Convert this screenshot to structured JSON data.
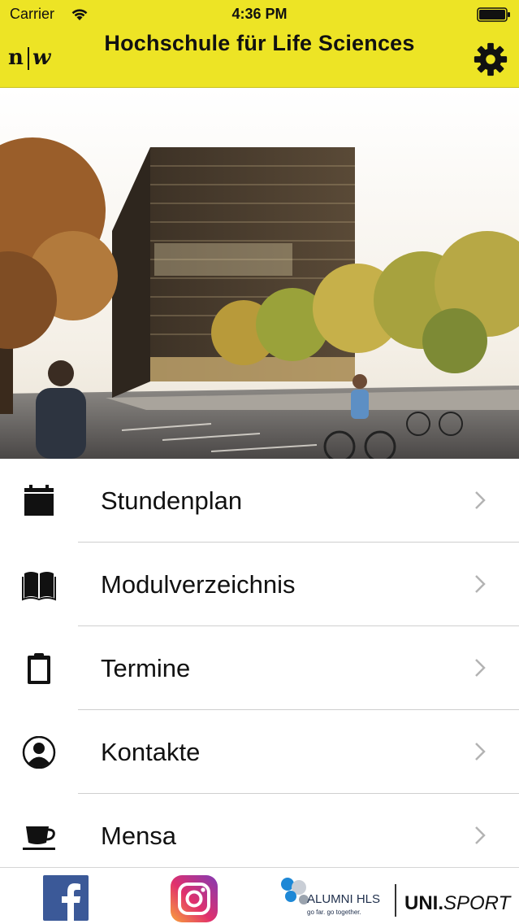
{
  "status_bar": {
    "carrier": "Carrier",
    "time": "4:36 PM"
  },
  "header": {
    "title": "Hochschule für Life Sciences",
    "logo_n": "n",
    "logo_w": "w",
    "accent_color": "#ede425"
  },
  "menu": {
    "items": [
      {
        "label": "Stundenplan",
        "icon": "calendar-icon"
      },
      {
        "label": "Modulverzeichnis",
        "icon": "book-icon"
      },
      {
        "label": "Termine",
        "icon": "clipboard-icon"
      },
      {
        "label": "Kontakte",
        "icon": "person-icon"
      },
      {
        "label": "Mensa",
        "icon": "coffee-cup-icon"
      }
    ]
  },
  "footer": {
    "alumni_label": "ALUMNI HLS",
    "alumni_tagline": "go far. go together.",
    "unisport_bold": "UNI.",
    "unisport_italic": "SPORT"
  }
}
